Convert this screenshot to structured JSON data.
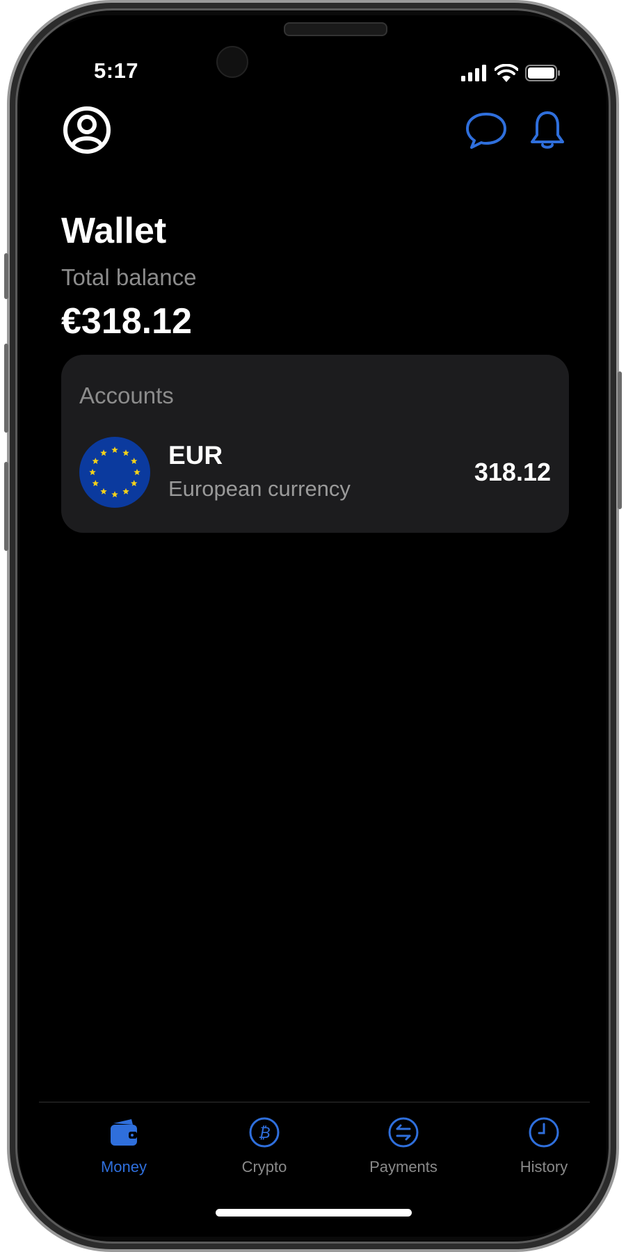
{
  "status_bar": {
    "time": "5:17"
  },
  "header": {
    "profile_icon": "user-circle-icon",
    "chat_icon": "chat-bubble-icon",
    "notifications_icon": "bell-icon"
  },
  "wallet": {
    "title": "Wallet",
    "total_balance_label": "Total balance",
    "total_balance_value": "€318.12"
  },
  "accounts": {
    "title": "Accounts",
    "items": [
      {
        "code": "EUR",
        "name": "European currency",
        "amount": "318.12",
        "icon": "eu-flag-icon"
      }
    ]
  },
  "tabbar": {
    "tabs": [
      {
        "label": "Money",
        "icon": "wallet-icon",
        "active": true
      },
      {
        "label": "Crypto",
        "icon": "bitcoin-icon",
        "active": false
      },
      {
        "label": "Payments",
        "icon": "transfer-arrows-icon",
        "active": false
      },
      {
        "label": "History",
        "icon": "clock-icon",
        "active": false
      }
    ]
  },
  "colors": {
    "accent": "#2f6fdc",
    "background": "#000000",
    "card": "#1c1c1e",
    "secondary_text": "#8c8c8c",
    "eu_blue": "#0b3a9e",
    "eu_star": "#f4d21a"
  }
}
